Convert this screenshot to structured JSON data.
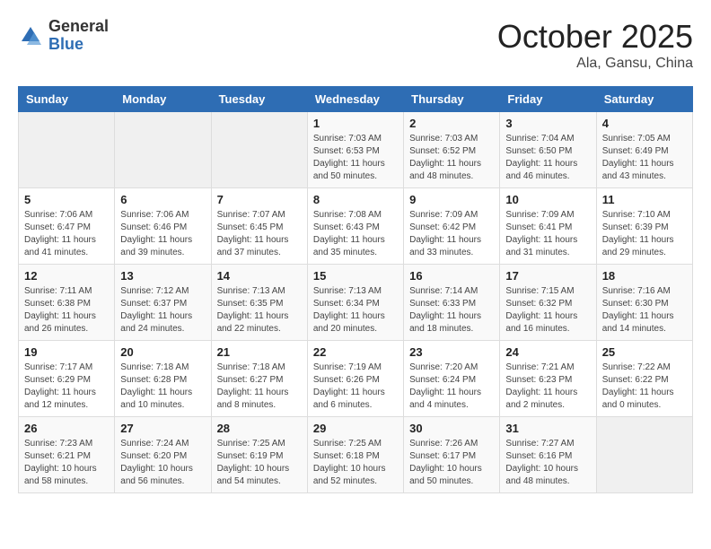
{
  "header": {
    "logo_general": "General",
    "logo_blue": "Blue",
    "month": "October 2025",
    "location": "Ala, Gansu, China"
  },
  "weekdays": [
    "Sunday",
    "Monday",
    "Tuesday",
    "Wednesday",
    "Thursday",
    "Friday",
    "Saturday"
  ],
  "weeks": [
    [
      {
        "day": "",
        "info": ""
      },
      {
        "day": "",
        "info": ""
      },
      {
        "day": "",
        "info": ""
      },
      {
        "day": "1",
        "info": "Sunrise: 7:03 AM\nSunset: 6:53 PM\nDaylight: 11 hours\nand 50 minutes."
      },
      {
        "day": "2",
        "info": "Sunrise: 7:03 AM\nSunset: 6:52 PM\nDaylight: 11 hours\nand 48 minutes."
      },
      {
        "day": "3",
        "info": "Sunrise: 7:04 AM\nSunset: 6:50 PM\nDaylight: 11 hours\nand 46 minutes."
      },
      {
        "day": "4",
        "info": "Sunrise: 7:05 AM\nSunset: 6:49 PM\nDaylight: 11 hours\nand 43 minutes."
      }
    ],
    [
      {
        "day": "5",
        "info": "Sunrise: 7:06 AM\nSunset: 6:47 PM\nDaylight: 11 hours\nand 41 minutes."
      },
      {
        "day": "6",
        "info": "Sunrise: 7:06 AM\nSunset: 6:46 PM\nDaylight: 11 hours\nand 39 minutes."
      },
      {
        "day": "7",
        "info": "Sunrise: 7:07 AM\nSunset: 6:45 PM\nDaylight: 11 hours\nand 37 minutes."
      },
      {
        "day": "8",
        "info": "Sunrise: 7:08 AM\nSunset: 6:43 PM\nDaylight: 11 hours\nand 35 minutes."
      },
      {
        "day": "9",
        "info": "Sunrise: 7:09 AM\nSunset: 6:42 PM\nDaylight: 11 hours\nand 33 minutes."
      },
      {
        "day": "10",
        "info": "Sunrise: 7:09 AM\nSunset: 6:41 PM\nDaylight: 11 hours\nand 31 minutes."
      },
      {
        "day": "11",
        "info": "Sunrise: 7:10 AM\nSunset: 6:39 PM\nDaylight: 11 hours\nand 29 minutes."
      }
    ],
    [
      {
        "day": "12",
        "info": "Sunrise: 7:11 AM\nSunset: 6:38 PM\nDaylight: 11 hours\nand 26 minutes."
      },
      {
        "day": "13",
        "info": "Sunrise: 7:12 AM\nSunset: 6:37 PM\nDaylight: 11 hours\nand 24 minutes."
      },
      {
        "day": "14",
        "info": "Sunrise: 7:13 AM\nSunset: 6:35 PM\nDaylight: 11 hours\nand 22 minutes."
      },
      {
        "day": "15",
        "info": "Sunrise: 7:13 AM\nSunset: 6:34 PM\nDaylight: 11 hours\nand 20 minutes."
      },
      {
        "day": "16",
        "info": "Sunrise: 7:14 AM\nSunset: 6:33 PM\nDaylight: 11 hours\nand 18 minutes."
      },
      {
        "day": "17",
        "info": "Sunrise: 7:15 AM\nSunset: 6:32 PM\nDaylight: 11 hours\nand 16 minutes."
      },
      {
        "day": "18",
        "info": "Sunrise: 7:16 AM\nSunset: 6:30 PM\nDaylight: 11 hours\nand 14 minutes."
      }
    ],
    [
      {
        "day": "19",
        "info": "Sunrise: 7:17 AM\nSunset: 6:29 PM\nDaylight: 11 hours\nand 12 minutes."
      },
      {
        "day": "20",
        "info": "Sunrise: 7:18 AM\nSunset: 6:28 PM\nDaylight: 11 hours\nand 10 minutes."
      },
      {
        "day": "21",
        "info": "Sunrise: 7:18 AM\nSunset: 6:27 PM\nDaylight: 11 hours\nand 8 minutes."
      },
      {
        "day": "22",
        "info": "Sunrise: 7:19 AM\nSunset: 6:26 PM\nDaylight: 11 hours\nand 6 minutes."
      },
      {
        "day": "23",
        "info": "Sunrise: 7:20 AM\nSunset: 6:24 PM\nDaylight: 11 hours\nand 4 minutes."
      },
      {
        "day": "24",
        "info": "Sunrise: 7:21 AM\nSunset: 6:23 PM\nDaylight: 11 hours\nand 2 minutes."
      },
      {
        "day": "25",
        "info": "Sunrise: 7:22 AM\nSunset: 6:22 PM\nDaylight: 11 hours\nand 0 minutes."
      }
    ],
    [
      {
        "day": "26",
        "info": "Sunrise: 7:23 AM\nSunset: 6:21 PM\nDaylight: 10 hours\nand 58 minutes."
      },
      {
        "day": "27",
        "info": "Sunrise: 7:24 AM\nSunset: 6:20 PM\nDaylight: 10 hours\nand 56 minutes."
      },
      {
        "day": "28",
        "info": "Sunrise: 7:25 AM\nSunset: 6:19 PM\nDaylight: 10 hours\nand 54 minutes."
      },
      {
        "day": "29",
        "info": "Sunrise: 7:25 AM\nSunset: 6:18 PM\nDaylight: 10 hours\nand 52 minutes."
      },
      {
        "day": "30",
        "info": "Sunrise: 7:26 AM\nSunset: 6:17 PM\nDaylight: 10 hours\nand 50 minutes."
      },
      {
        "day": "31",
        "info": "Sunrise: 7:27 AM\nSunset: 6:16 PM\nDaylight: 10 hours\nand 48 minutes."
      },
      {
        "day": "",
        "info": ""
      }
    ]
  ]
}
